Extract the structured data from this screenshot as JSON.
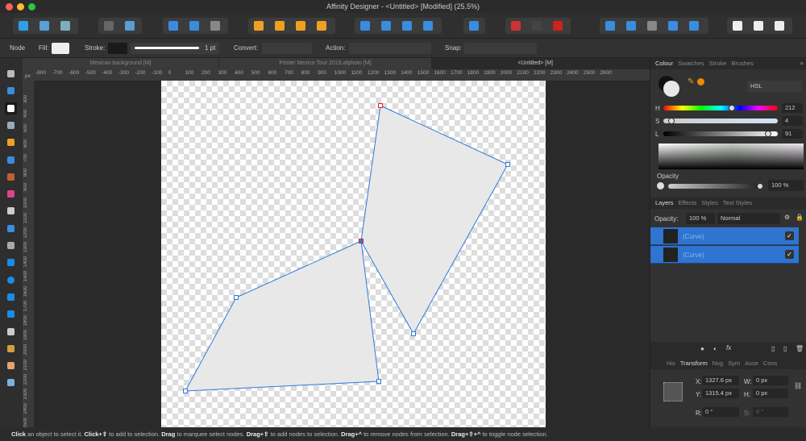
{
  "window": {
    "title": "Affinity Designer - <Untitled> [Modified] (25.5%)"
  },
  "toolbar": {
    "icons": [
      "designer-persona-icon",
      "pixel-persona-icon",
      "export-persona-icon",
      "isolate-icon",
      "mask-icon",
      "select-all-icon",
      "select-inverse-icon",
      "transform-select-icon",
      "move-back-icon",
      "move-backward-icon",
      "move-forward-icon",
      "move-front-icon",
      "flip-horizontal-icon",
      "flip-vertical-icon",
      "rotate-left-icon",
      "rotate-right-icon",
      "align-icon",
      "snap-grid-icon",
      "snap-toggle-icon",
      "snapping-magnet-icon",
      "add-icon",
      "subtract-icon",
      "intersect-icon",
      "xor-icon",
      "divide-icon",
      "insert-back-icon",
      "insert-front-icon",
      "insert-inside-icon"
    ]
  },
  "context": {
    "tool": "Node",
    "fill_label": "Fill:",
    "stroke_label": "Stroke:",
    "stroke_width": "1 pt",
    "convert_label": "Convert:",
    "action_label": "Action:",
    "snap_label": "Snap:"
  },
  "doc_tabs": [
    "Mexican background [M]",
    "Póster Mexico Tour 2019.afphoto [M]",
    "<Untitled> [M]"
  ],
  "ruler": {
    "unit": "px",
    "h_ticks": [
      "-800",
      "-700",
      "-600",
      "-500",
      "-400",
      "-300",
      "-200",
      "-100",
      "0",
      "100",
      "200",
      "300",
      "400",
      "500",
      "600",
      "700",
      "800",
      "900",
      "1000",
      "1100",
      "1200",
      "1300",
      "1400",
      "1500",
      "1600",
      "1700",
      "1800",
      "1900",
      "2000",
      "2100",
      "2200",
      "2300",
      "2400",
      "2500",
      "2600"
    ],
    "v_ticks": [
      "300",
      "400",
      "500",
      "600",
      "700",
      "800",
      "900",
      "1000",
      "1100",
      "1200",
      "1300",
      "1400",
      "1500",
      "1600",
      "1700",
      "1800",
      "1900",
      "2000",
      "2100",
      "2200",
      "2300",
      "2400",
      "2500"
    ]
  },
  "tools": [
    "move-tool-icon",
    "artboard-tool-icon",
    "node-tool-icon",
    "corner-tool-icon",
    "pen-tool-icon",
    "pencil-tool-icon",
    "vector-brush-icon",
    "fill-tool-icon",
    "transparency-tool-icon",
    "place-image-icon",
    "crop-tool-icon",
    "rectangle-tool-icon",
    "ellipse-tool-icon",
    "rounded-rect-tool-icon",
    "triangle-tool-icon",
    "text-tool-icon",
    "color-picker-icon",
    "hand-tool-icon",
    "zoom-tool-icon"
  ],
  "colour_panel": {
    "tabs": [
      "Colour",
      "Swatches",
      "Stroke",
      "Brushes"
    ],
    "mode": "HSL",
    "h": "212",
    "s": "4",
    "l": "91",
    "h_frac": 0.59,
    "s_frac": 0.04,
    "l_frac": 0.91,
    "opacity_label": "Opacity",
    "opacity": "100 %",
    "accent": "#f08a00"
  },
  "layers_panel": {
    "tabs": [
      "Layers",
      "Effects",
      "Styles",
      "Text Styles"
    ],
    "opacity_label": "Opacity:",
    "opacity": "100 %",
    "blend": "Normal",
    "layers": [
      {
        "name": "(Curve)"
      },
      {
        "name": "(Curve)"
      }
    ]
  },
  "transform_panel": {
    "tabs": [
      "His",
      "Transform",
      "Nvg",
      "Sym",
      "Asse",
      "Cons"
    ],
    "x_label": "X:",
    "x": "1327.6 px",
    "y_label": "Y:",
    "y": "1315.4 px",
    "w_label": "W:",
    "w": "0 px",
    "h_label": "H:",
    "h": "0 px",
    "r_label": "R:",
    "r": "0 °",
    "s_label": "S:",
    "s": "0 °"
  },
  "status": {
    "parts": [
      [
        "Click",
        " an object to select it. "
      ],
      [
        "Click+⇧",
        " to add to selection. "
      ],
      [
        "Drag",
        " to marquee select nodes. "
      ],
      [
        "Drag+⇧",
        " to add nodes to selection. "
      ],
      [
        "Drag+^",
        " to remove nodes from selection. "
      ],
      [
        "Drag+⇧+^",
        " to toggle node selection."
      ]
    ]
  }
}
